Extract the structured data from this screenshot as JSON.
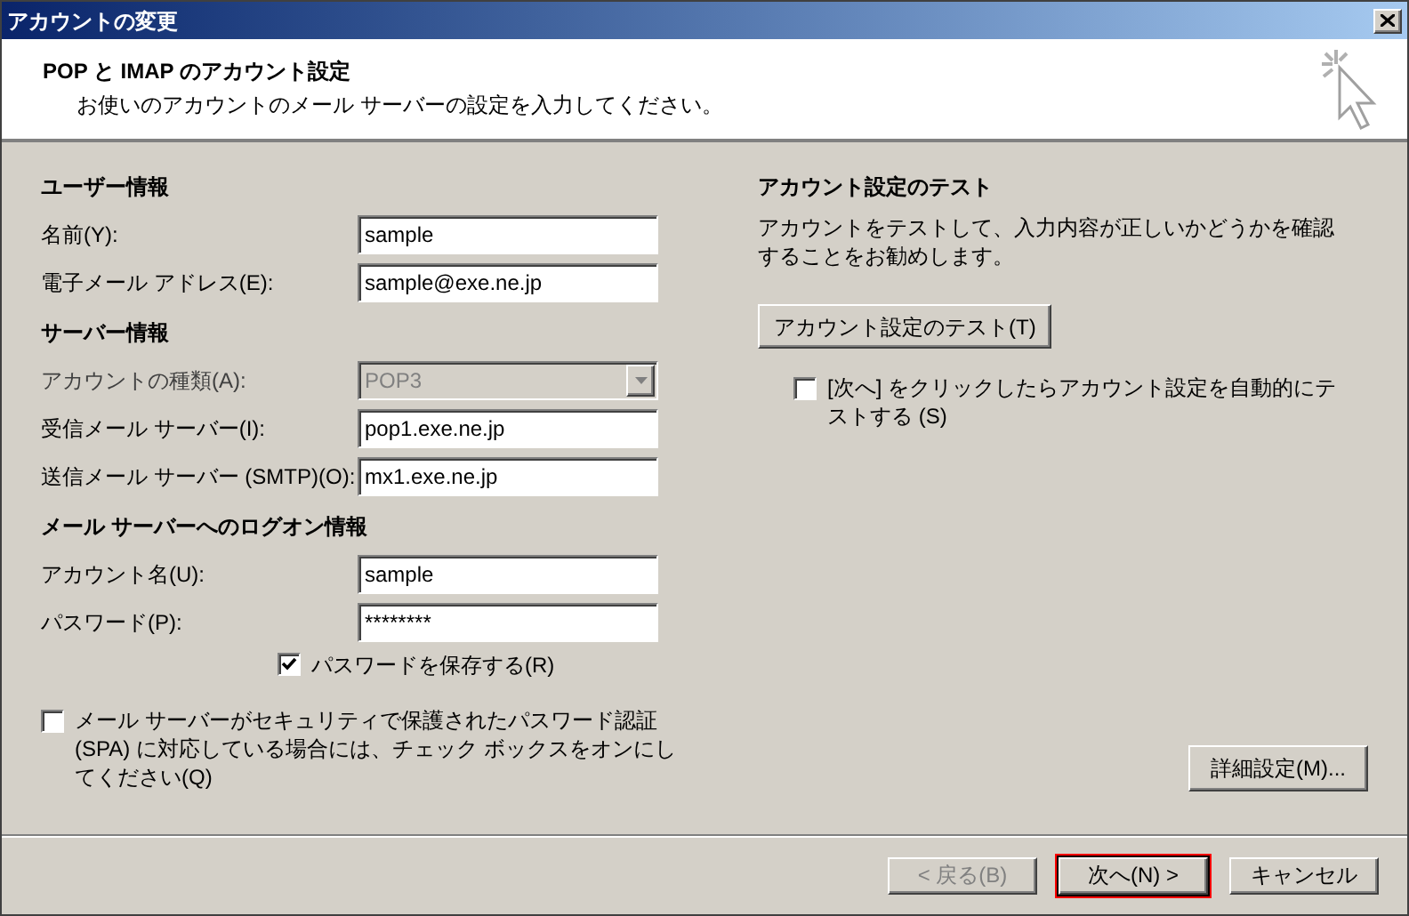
{
  "window": {
    "title": "アカウントの変更"
  },
  "header": {
    "title": "POP と IMAP のアカウント設定",
    "subtitle": "お使いのアカウントのメール サーバーの設定を入力してください。"
  },
  "sections": [
    {
      "heading": "ユーザー情報",
      "fields": [
        {
          "kind": "text",
          "label": "名前(Y):",
          "value": "sample",
          "disabled": false
        },
        {
          "kind": "text",
          "label": "電子メール アドレス(E):",
          "value": "sample@exe.ne.jp",
          "disabled": false
        }
      ]
    },
    {
      "heading": "サーバー情報",
      "fields": [
        {
          "kind": "dropdown",
          "label": "アカウントの種類(A):",
          "value": "POP3",
          "disabled": true
        },
        {
          "kind": "text",
          "label": "受信メール サーバー(I):",
          "value": "pop1.exe.ne.jp",
          "disabled": false
        },
        {
          "kind": "text",
          "label": "送信メール サーバー (SMTP)(O):",
          "value": "mx1.exe.ne.jp",
          "disabled": false
        }
      ]
    },
    {
      "heading": "メール サーバーへのログオン情報",
      "fields": [
        {
          "kind": "text",
          "label": "アカウント名(U):",
          "value": "sample",
          "disabled": false
        },
        {
          "kind": "text",
          "label": "パスワード(P):",
          "value": "********",
          "disabled": false
        }
      ]
    }
  ],
  "save_password": {
    "label": "パスワードを保存する(R)",
    "checked": true
  },
  "spa": {
    "label": "メール サーバーがセキュリティで保護されたパスワード認証 (SPA) に対応している場合には、チェック ボックスをオンにしてください(Q)",
    "checked": false
  },
  "test": {
    "heading": "アカウント設定のテスト",
    "description": "アカウントをテストして、入力内容が正しいかどうかを確認することをお勧めします。",
    "button": "アカウント設定のテスト(T)",
    "auto_test": {
      "label": "[次へ] をクリックしたらアカウント設定を自動的にテストする (S)",
      "checked": false
    }
  },
  "more_settings_button": "詳細設定(M)...",
  "buttons": [
    {
      "label": "< 戻る(B)",
      "disabled": true,
      "highlighted": false
    },
    {
      "label": "次へ(N) >",
      "disabled": false,
      "highlighted": true
    },
    {
      "label": "キャンセル",
      "disabled": false,
      "highlighted": false
    }
  ]
}
